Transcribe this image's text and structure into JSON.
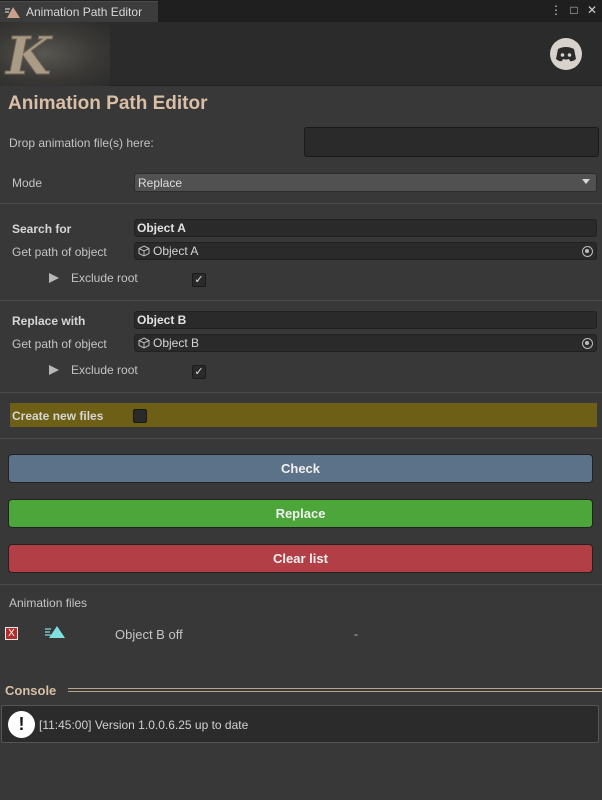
{
  "tab": {
    "title": "Animation Path Editor"
  },
  "window_controls": {
    "more": "⋮",
    "maximize": "□",
    "close": "✕"
  },
  "header": {
    "title": "Animation Path Editor"
  },
  "drop": {
    "label": "Drop animation file(s) here:"
  },
  "mode": {
    "label": "Mode",
    "value": "Replace"
  },
  "search": {
    "label": "Search for",
    "value": "Object A",
    "path_label": "Get path of object",
    "object": "Object A",
    "exclude_label": "Exclude root",
    "exclude_checked": true
  },
  "replace": {
    "label": "Replace with",
    "value": "Object B",
    "path_label": "Get path of object",
    "object": "Object B",
    "exclude_label": "Exclude root",
    "exclude_checked": true
  },
  "create_new_files": {
    "label": "Create new files",
    "checked": false
  },
  "buttons": {
    "check": "Check",
    "replace": "Replace",
    "clear": "Clear list"
  },
  "animation_files": {
    "heading": "Animation files",
    "items": [
      {
        "remove": "X",
        "name": "Object B off",
        "status": "-"
      }
    ]
  },
  "console": {
    "heading": "Console",
    "icon": "!",
    "message": "[11:45:00] Version 1.0.0.6.25 up to date"
  },
  "colors": {
    "accent": "#d8bfa6",
    "check": "#5c7288",
    "replace": "#4da63a",
    "clear": "#b23f46",
    "highlight": "#6d5f16"
  }
}
